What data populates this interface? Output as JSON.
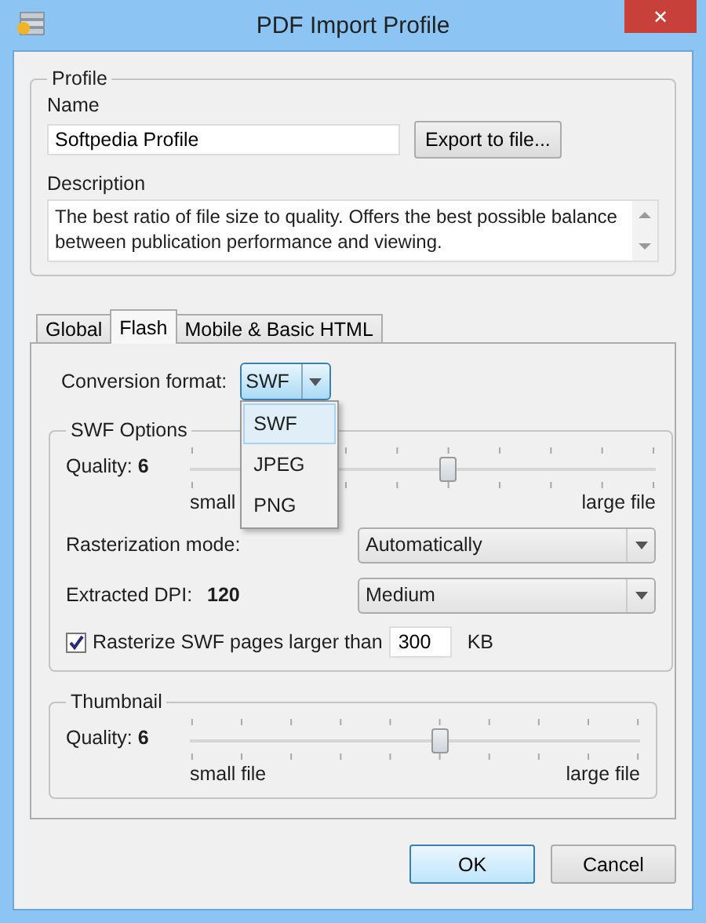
{
  "window": {
    "title": "PDF Import Profile",
    "close": "✕"
  },
  "profile": {
    "legend": "Profile",
    "name_label": "Name",
    "name_value": "Softpedia Profile",
    "export_button": "Export to file...",
    "description_label": "Description",
    "description": "The best ratio of file size to quality. Offers the best possible balance between publication performance and viewing."
  },
  "tabs": [
    {
      "label": "Global",
      "selected": false
    },
    {
      "label": "Flash",
      "selected": true
    },
    {
      "label": "Mobile & Basic HTML",
      "selected": false
    }
  ],
  "conversion_format": {
    "label": "Conversion format:",
    "value": "SWF",
    "open": true,
    "options": [
      {
        "label": "SWF",
        "selected": true
      },
      {
        "label": "JPEG",
        "selected": false
      },
      {
        "label": "PNG",
        "selected": false
      }
    ]
  },
  "swf_options": {
    "legend": "SWF Options",
    "quality_label": "Quality:",
    "quality_value": "6",
    "level": 0.555,
    "min_label": "small",
    "max_label": "large file",
    "rasterization_label": "Rasterization mode:",
    "rasterization_value": "Automatically",
    "dpi_label": "Extracted DPI:",
    "dpi_value": "120",
    "dpi_preset": "Medium",
    "rasterize_checked": true,
    "rasterize_label": "Rasterize SWF pages larger than",
    "rasterize_value": "300",
    "rasterize_unit": "KB"
  },
  "thumbnail": {
    "legend": "Thumbnail",
    "quality_label": "Quality:",
    "quality_value": "6",
    "level": 0.556,
    "min_label": "small file",
    "max_label": "large file"
  },
  "buttons": [
    {
      "label": "OK",
      "kind": "default"
    },
    {
      "label": "Cancel",
      "kind": "normal"
    }
  ]
}
